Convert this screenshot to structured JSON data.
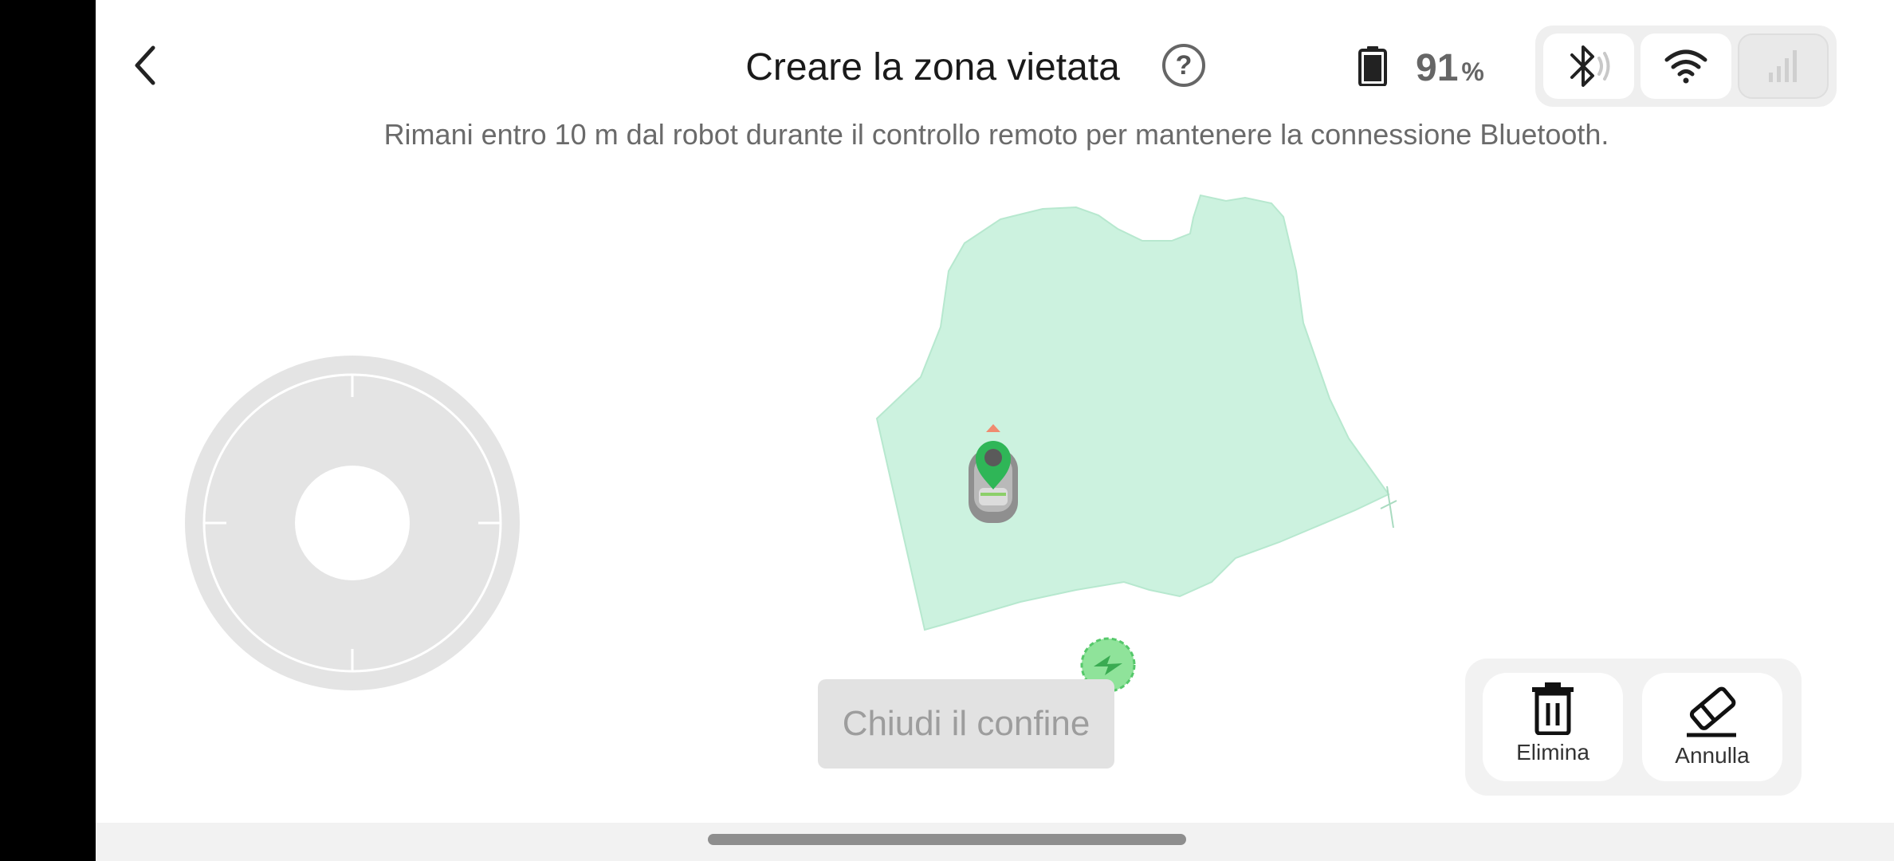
{
  "header": {
    "back_icon": "chevron-left-icon",
    "title": "Creare la zona vietata",
    "help_icon": "question-circle-icon",
    "help_glyph": "?"
  },
  "status": {
    "battery_icon": "battery-icon",
    "battery_value": "91",
    "battery_unit": "%",
    "bluetooth_icon": "bluetooth-icon",
    "wifi_icon": "wifi-icon",
    "cellular_icon": "cellular-signal-icon"
  },
  "notice": "Rimani entro 10 m dal robot durante il controllo remoto per mantenere la connessione Bluetooth.",
  "joystick_icon": "joystick-icon",
  "map": {
    "zone_color": "#ccf2df",
    "robot_icon": "robot-mower-icon",
    "location_pin_icon": "location-pin-icon",
    "charging_station_icon": "charging-station-icon",
    "accent_green": "#2fb657"
  },
  "actions": {
    "close_boundary_label": "Chiudi il confine",
    "delete_label": "Elimina",
    "delete_icon": "trash-icon",
    "undo_label": "Annulla",
    "undo_icon": "eraser-icon"
  }
}
